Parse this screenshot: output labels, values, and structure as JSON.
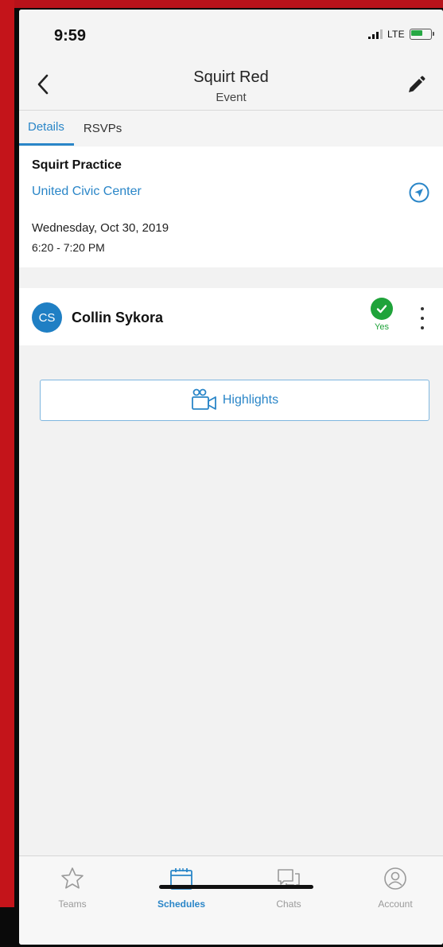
{
  "status_bar": {
    "time": "9:59",
    "network": "LTE"
  },
  "header": {
    "title": "Squirt Red",
    "subtitle": "Event"
  },
  "tabs": [
    {
      "label": "Details",
      "active": true
    },
    {
      "label": "RSVPs",
      "active": false
    }
  ],
  "event": {
    "name": "Squirt Practice",
    "location": "United Civic Center",
    "date": "Wednesday, Oct 30, 2019",
    "time": "6:20 - 7:20 PM"
  },
  "rsvp": {
    "initials": "CS",
    "name": "Collin Sykora",
    "status": "Yes"
  },
  "highlights_button": {
    "label": "Highlights"
  },
  "tabbar": [
    {
      "label": "Teams",
      "icon": "star-icon",
      "active": false
    },
    {
      "label": "Schedules",
      "icon": "calendar-icon",
      "active": true
    },
    {
      "label": "Chats",
      "icon": "chat-icon",
      "active": false
    },
    {
      "label": "Account",
      "icon": "account-icon",
      "active": false
    }
  ],
  "colors": {
    "accent": "#2a86c8",
    "success": "#1fa33a",
    "avatar": "#1f7fc4"
  }
}
